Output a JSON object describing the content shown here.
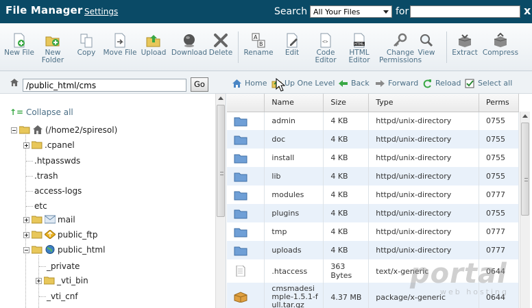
{
  "header": {
    "title": "File Manager",
    "settings_label": "Settings",
    "search_label": "Search",
    "search_scope": "All Your Files",
    "for_label": "for",
    "search_value": "",
    "close_label": "x",
    "bg_color": "#0a4a66"
  },
  "toolbar": {
    "buttons": [
      {
        "label": "New File",
        "icon": "new-file-icon"
      },
      {
        "label": "New Folder",
        "icon": "new-folder-icon"
      },
      {
        "label": "Copy",
        "icon": "copy-icon"
      },
      {
        "label": "Move File",
        "icon": "move-file-icon"
      },
      {
        "label": "Upload",
        "icon": "upload-icon"
      },
      {
        "label": "Download",
        "icon": "download-icon"
      },
      {
        "label": "Delete",
        "icon": "delete-icon"
      },
      {
        "label": "Rename",
        "icon": "rename-icon"
      },
      {
        "label": "Edit",
        "icon": "edit-icon"
      },
      {
        "label": "Code Editor",
        "icon": "code-editor-icon"
      },
      {
        "label": "HTML Editor",
        "icon": "html-editor-icon"
      },
      {
        "label": "Change Permissions",
        "icon": "permissions-icon"
      },
      {
        "label": "View",
        "icon": "view-icon"
      },
      {
        "label": "Extract",
        "icon": "extract-icon"
      },
      {
        "label": "Compress",
        "icon": "compress-icon"
      }
    ]
  },
  "pathbar": {
    "path_value": "/public_html/cms",
    "go_label": "Go",
    "nav": [
      {
        "label": "Home",
        "icon": "home-icon"
      },
      {
        "label": "Up One Level",
        "icon": "up-level-icon"
      },
      {
        "label": "Back",
        "icon": "back-icon"
      },
      {
        "label": "Forward",
        "icon": "forward-icon"
      },
      {
        "label": "Reload",
        "icon": "reload-icon"
      },
      {
        "label": "Select all",
        "icon": "checkbox-icon"
      }
    ]
  },
  "tree": {
    "collapse_label": "Collapse all",
    "root_label": "(/home2/spiresol)",
    "nodes": [
      {
        "label": ".cpanel"
      },
      {
        "label": ".htpasswds"
      },
      {
        "label": ".trash"
      },
      {
        "label": "access-logs"
      },
      {
        "label": "etc"
      },
      {
        "label": "mail"
      },
      {
        "label": "public_ftp"
      },
      {
        "label": "public_html"
      },
      {
        "label": "_private"
      },
      {
        "label": "_vti_bin"
      },
      {
        "label": "_vti_cnf"
      }
    ]
  },
  "files": {
    "columns": [
      "",
      "Name",
      "Size",
      "Type",
      "Perms"
    ],
    "rows": [
      {
        "name": "admin",
        "size": "4 KB",
        "type": "httpd/unix-directory",
        "perms": "0755",
        "kind": "folder"
      },
      {
        "name": "doc",
        "size": "4 KB",
        "type": "httpd/unix-directory",
        "perms": "0755",
        "kind": "folder"
      },
      {
        "name": "install",
        "size": "4 KB",
        "type": "httpd/unix-directory",
        "perms": "0755",
        "kind": "folder"
      },
      {
        "name": "lib",
        "size": "4 KB",
        "type": "httpd/unix-directory",
        "perms": "0755",
        "kind": "folder"
      },
      {
        "name": "modules",
        "size": "4 KB",
        "type": "httpd/unix-directory",
        "perms": "0777",
        "kind": "folder"
      },
      {
        "name": "plugins",
        "size": "4 KB",
        "type": "httpd/unix-directory",
        "perms": "0755",
        "kind": "folder"
      },
      {
        "name": "tmp",
        "size": "4 KB",
        "type": "httpd/unix-directory",
        "perms": "0777",
        "kind": "folder"
      },
      {
        "name": "uploads",
        "size": "4 KB",
        "type": "httpd/unix-directory",
        "perms": "0777",
        "kind": "folder"
      },
      {
        "name": ".htaccess",
        "size": "363 Bytes",
        "type": "text/x-generic",
        "perms": "0644",
        "kind": "text"
      },
      {
        "name": "cmsmadesimple-1.5.1-full.tar.gz",
        "size": "4.37 MB",
        "type": "package/x-generic",
        "perms": "0644",
        "kind": "package"
      }
    ]
  },
  "watermark": {
    "big": "portal",
    "small": "web hosting"
  }
}
